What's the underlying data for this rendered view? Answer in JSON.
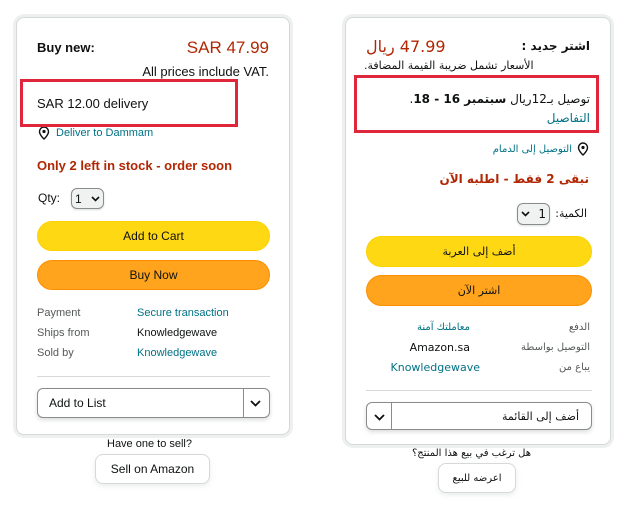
{
  "en": {
    "buy_new_label": "Buy new:",
    "price": "SAR 47.99",
    "vat_note": "All prices include VAT.",
    "delivery": "SAR 12.00 delivery",
    "deliver_to": "Deliver to Dammam",
    "stock": "Only 2 left in stock - order soon",
    "qty_label": "Qty:",
    "qty_value": "1",
    "add_to_cart": "Add to Cart",
    "buy_now": "Buy Now",
    "info_rows": [
      {
        "label": "Payment",
        "value": "Secure transaction"
      },
      {
        "label": "Ships from",
        "value": "Knowledgewave"
      },
      {
        "label": "Sold by",
        "value": "Knowledgewave"
      }
    ],
    "add_to_list": "Add to List",
    "have_one": "Have one to sell?",
    "sell_on_amazon": "Sell on Amazon"
  },
  "ar": {
    "buy_new_label": "اشتر جديد :",
    "price": "47.99 ريال",
    "vat_note": "الأسعار تشمل ضريبة القيمة المضافة.",
    "delivery_prefix": "توصيل بـ12ريال",
    "delivery_date": "سبتمبر 16 - 18",
    "delivery_suffix": ".",
    "details": "التفاصيل",
    "deliver_to": "التوصيل إلى الدمام",
    "stock": "تبقى 2 فقط - اطلبه الآن",
    "qty_label": "الكمية:",
    "qty_value": "1",
    "add_to_cart": "أضف إلى العربة",
    "buy_now": "اشتر الآن",
    "info_rows": [
      {
        "label": "الدفع",
        "value": "معاملتك آمنة"
      },
      {
        "label": "التوصيل بواسطة",
        "value": "Amazon.sa"
      },
      {
        "label": "يباع من",
        "value": "Knowledgewave"
      }
    ],
    "add_to_list": "أضف إلى القائمة",
    "have_one": "هل ترغب في بيع هذا المنتج؟",
    "sell_on_amazon": "اعرضه للبيع"
  },
  "colors": {
    "price_red": "#b12704",
    "link_teal": "#007185",
    "button_yellow": "#ffd814",
    "button_orange": "#ffa41c",
    "highlight_red": "#e0263b"
  }
}
